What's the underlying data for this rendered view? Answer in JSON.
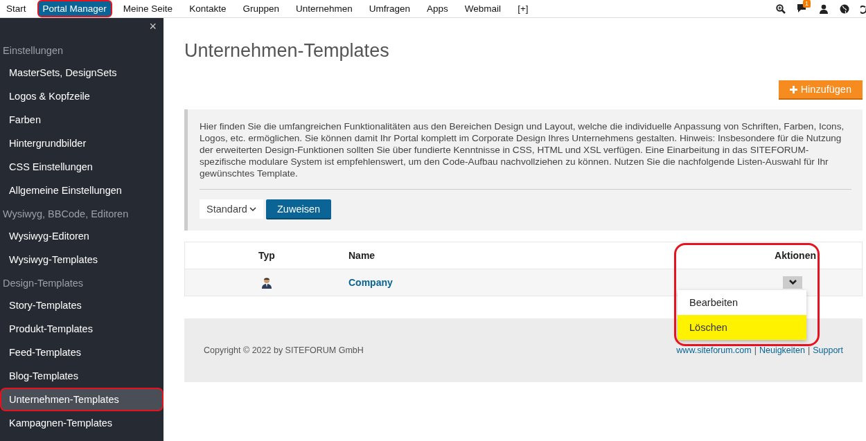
{
  "top_nav": {
    "items": [
      {
        "label": "Start",
        "selected": false,
        "highlighted": false
      },
      {
        "label": "Portal Manager",
        "selected": true,
        "highlighted": true
      },
      {
        "label": "Meine Seite",
        "selected": false,
        "highlighted": false
      },
      {
        "label": "Kontakte",
        "selected": false,
        "highlighted": false
      },
      {
        "label": "Gruppen",
        "selected": false,
        "highlighted": false
      },
      {
        "label": "Unternehmen",
        "selected": false,
        "highlighted": false
      },
      {
        "label": "Umfragen",
        "selected": false,
        "highlighted": false
      },
      {
        "label": "Apps",
        "selected": false,
        "highlighted": false
      },
      {
        "label": "Webmail",
        "selected": false,
        "highlighted": false
      },
      {
        "label": "[+]",
        "selected": false,
        "highlighted": false
      }
    ],
    "notification_count": "1"
  },
  "sidebar": {
    "close": "×",
    "sections": [
      {
        "title": "Einstellungen",
        "items": [
          {
            "label": "MasterSets, DesignSets",
            "selected": false,
            "highlighted": false
          },
          {
            "label": "Logos & Kopfzeile",
            "selected": false,
            "highlighted": false
          },
          {
            "label": "Farben",
            "selected": false,
            "highlighted": false
          },
          {
            "label": "Hintergrundbilder",
            "selected": false,
            "highlighted": false
          },
          {
            "label": "CSS Einstellungen",
            "selected": false,
            "highlighted": false
          },
          {
            "label": "Allgemeine Einstellungen",
            "selected": false,
            "highlighted": false
          }
        ]
      },
      {
        "title": "Wysiwyg, BBCode, Editoren",
        "items": [
          {
            "label": "Wysiwyg-Editoren",
            "selected": false,
            "highlighted": false
          },
          {
            "label": "Wysiwyg-Templates",
            "selected": false,
            "highlighted": false
          }
        ]
      },
      {
        "title": "Design-Templates",
        "items": [
          {
            "label": "Story-Templates",
            "selected": false,
            "highlighted": false
          },
          {
            "label": "Produkt-Templates",
            "selected": false,
            "highlighted": false
          },
          {
            "label": "Feed-Templates",
            "selected": false,
            "highlighted": false
          },
          {
            "label": "Blog-Templates",
            "selected": false,
            "highlighted": false
          },
          {
            "label": "Unternehmen-Templates",
            "selected": true,
            "highlighted": true
          },
          {
            "label": "Kampagnen-Templates",
            "selected": false,
            "highlighted": false
          }
        ]
      }
    ]
  },
  "page": {
    "title": "Unternehmen-Templates",
    "add_button": "Hinzufügen",
    "info_text": "Hier finden Sie die umfangreichen Funktionalitäten aus den Bereichen Design und Layout, welche die individuelle Anpassung von Schriften, Farben, Icons, Logos, etc. ermöglichen. Sie können damit Ihr Portal komplett im Corporate Design Ihres Unternehmens gestalten. Hinweis: Insbesondere für die Nutzung der erweiterten Design-Funktionen sollten Sie über fundierte Kenntnisse in CSS, HTML und XSL verfügen. Eine Einarbeitung in das SITEFORUM-spezifische modulare System ist empfehlenswert, um den Code-Aufbau nachvollziehen zu können. Nutzen Sie die nachfolgende Listen-Auswahl für Ihr gewünschtes Template.",
    "template_select": {
      "value": "Standard"
    },
    "assign_button": "Zuweisen"
  },
  "table": {
    "columns": [
      "Typ",
      "Name",
      "Aktionen"
    ],
    "actions_highlighted": true,
    "rows": [
      {
        "name": "Company"
      }
    ],
    "menu": [
      {
        "label": "Bearbeiten",
        "selected": false
      },
      {
        "label": "Löschen",
        "selected": true
      }
    ]
  },
  "footer": {
    "copyright": "Copyright © 2022 by SITEFORUM GmbH",
    "links": [
      "www.siteforum.com",
      "Neuigkeiten",
      "Support"
    ],
    "separator": "|"
  }
}
